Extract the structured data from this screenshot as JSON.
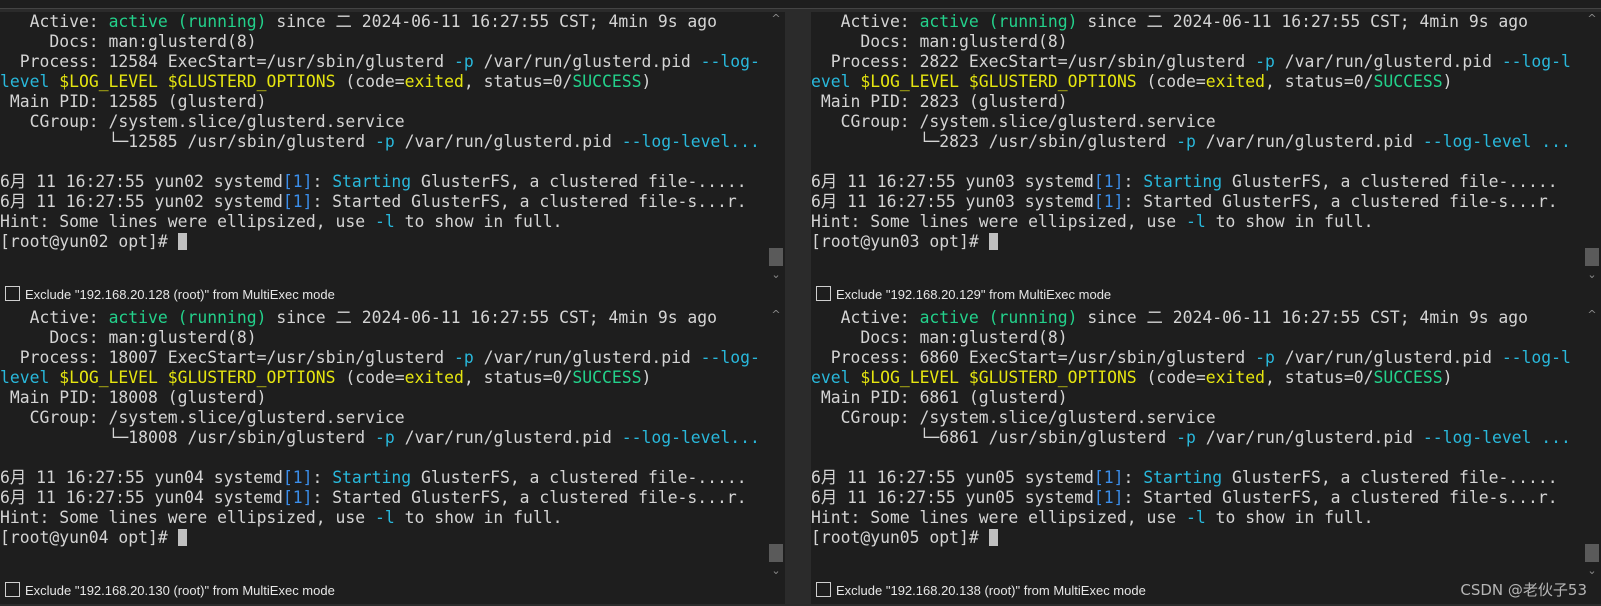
{
  "panes": [
    {
      "process_pid": "12584",
      "main_pid": "12585",
      "child_pid": "12585",
      "child_tail": "--log-level...",
      "host": "yun02",
      "wrap": "--log-",
      "wrap2": "level",
      "exclude": "Exclude \"192.168.20.128 (root)\" from MultiExec mode"
    },
    {
      "process_pid": "2822",
      "main_pid": "2823",
      "child_pid": "2823",
      "child_tail": "--log-level ...",
      "host": "yun03",
      "wrap": "--log-l",
      "wrap2": "evel",
      "exclude": "Exclude \"192.168.20.129\" from MultiExec mode"
    },
    {
      "process_pid": "18007",
      "main_pid": "18008",
      "child_pid": "18008",
      "child_tail": "--log-level...",
      "host": "yun04",
      "wrap": "--log-",
      "wrap2": "level",
      "exclude": "Exclude \"192.168.20.130 (root)\" from MultiExec mode"
    },
    {
      "process_pid": "6860",
      "main_pid": "6861",
      "child_pid": "6861",
      "child_tail": "--log-level ...",
      "host": "yun05",
      "wrap": "--log-l",
      "wrap2": "evel",
      "exclude": "Exclude \"192.168.20.138 (root)\" from MultiExec mode"
    }
  ],
  "common": {
    "active_label": "   Active: ",
    "active_state": "active (running)",
    "active_rest": " since 二 2024-06-11 16:27:55 CST; 4min 9s ago",
    "docs": "     Docs: man:glusterd(8)",
    "process_label": "  Process: ",
    "exec": " ExecStart=/usr/sbin/glusterd ",
    "flag_p": "-p",
    "pidfile": " /var/run/glusterd.pid ",
    "log_level_var": "$LOG_LEVEL",
    "options_var": "$GLUSTERD_OPTIONS",
    "code_open": " (code=",
    "exited": "exited",
    "status_mid": ", status=0/",
    "success": "SUCCESS",
    "close": ")",
    "mainpid_label": " Main PID: ",
    "mainpid_suffix": " (glusterd)",
    "cgroup": "   CGroup: /system.slice/glusterd.service",
    "tree_prefix": "           └─",
    "child_cmd": " /usr/sbin/glusterd ",
    "log_date": "6月 11 16:27:55 ",
    "systemd": " systemd",
    "unit_num": "[1]",
    "starting_word": "Starting",
    "starting_rest": " GlusterFS, a clustered file-.....",
    "started_rest": " Started GlusterFS, a clustered file-s...r.",
    "hint_a": "Hint: Some lines were ellipsized, use ",
    "hint_flag": "-l",
    "hint_b": " to show in full.",
    "prompt_open": "[root@",
    "prompt_close": " opt]# "
  },
  "watermark": "CSDN @老伙子53"
}
